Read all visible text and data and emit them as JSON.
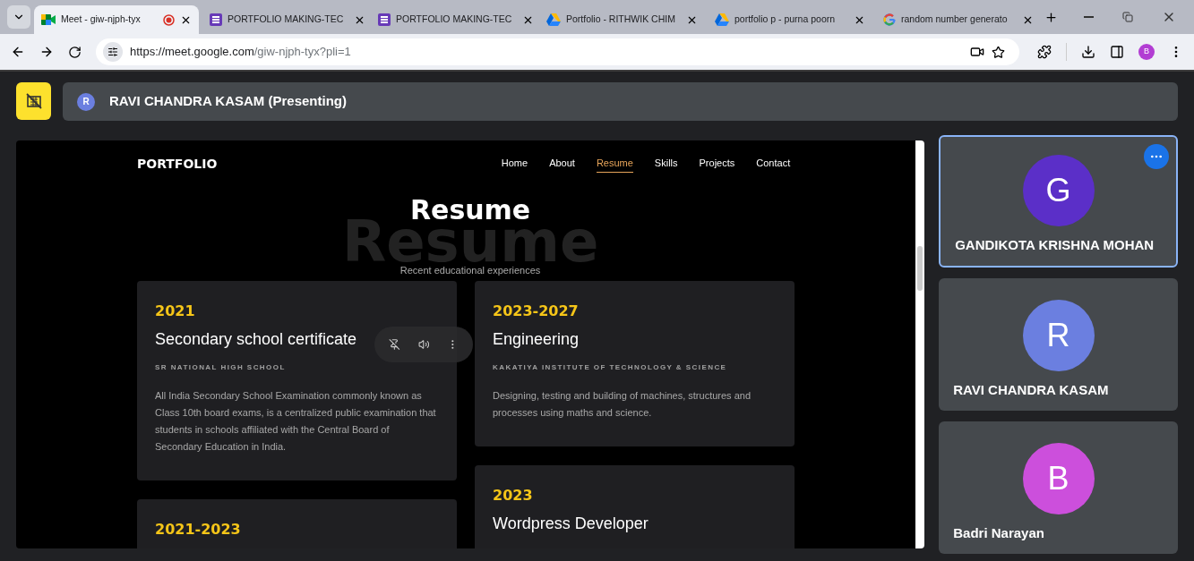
{
  "browser": {
    "tabs": [
      {
        "title": "Meet - giw-njph-tyx",
        "kind": "meet",
        "selected": true,
        "recording": true
      },
      {
        "title": "PORTFOLIO MAKING-TEC",
        "kind": "forms",
        "selected": false,
        "recording": false
      },
      {
        "title": "PORTFOLIO MAKING-TEC",
        "kind": "forms",
        "selected": false,
        "recording": false
      },
      {
        "title": "Portfolio - RITHWIK CHIM",
        "kind": "drive",
        "selected": false,
        "recording": false
      },
      {
        "title": "portfolio p - purna poorn",
        "kind": "drive",
        "selected": false,
        "recording": false
      },
      {
        "title": "random number generato",
        "kind": "google",
        "selected": false,
        "recording": false
      }
    ],
    "url_host": "https://meet.google.com",
    "url_path": "/giw-njph-tyx?pli=1",
    "profile_initial": "B"
  },
  "meet": {
    "presenter": {
      "initial": "R",
      "name": "RAVI CHANDRA KASAM (Presenting)"
    },
    "presentation": {
      "logo": "PORTFOLIO",
      "nav": [
        {
          "label": "Home",
          "selected": false
        },
        {
          "label": "About",
          "selected": false
        },
        {
          "label": "Resume",
          "selected": true
        },
        {
          "label": "Skills",
          "selected": false
        },
        {
          "label": "Projects",
          "selected": false
        },
        {
          "label": "Contact",
          "selected": false
        }
      ],
      "title": "Resume",
      "background_word": "Resume",
      "subtitle": "Recent educational experiences",
      "columns": [
        [
          {
            "year": "2021",
            "title": "Secondary school certificate",
            "school": "SR NATIONAL HIGH SCHOOL",
            "text": "All India Secondary School Examination commonly known as Class 10th board exams, is a centralized public examination that students in schools affiliated with the Central Board of Secondary Education in India."
          },
          {
            "year": "2021-2023"
          }
        ],
        [
          {
            "year": "2023-2027",
            "title": "Engineering",
            "school": "KAKATIYA INSTITUTE OF TECHNOLOGY & SCIENCE",
            "text": "Designing, testing and building of machines, structures and processes using maths and science."
          },
          {
            "year": "2023",
            "title": "Wordpress Developer"
          }
        ]
      ]
    },
    "participants": [
      {
        "initial": "G",
        "name": "GANDIKOTA KRISHNA MOHAN",
        "color": "#5b2fc8",
        "selected": true
      },
      {
        "initial": "R",
        "name": "RAVI CHANDRA KASAM",
        "color": "#6b7fe0",
        "selected": false
      },
      {
        "initial": "B",
        "name": "Badri Narayan",
        "color": "#cc4fdc",
        "selected": false
      }
    ]
  }
}
